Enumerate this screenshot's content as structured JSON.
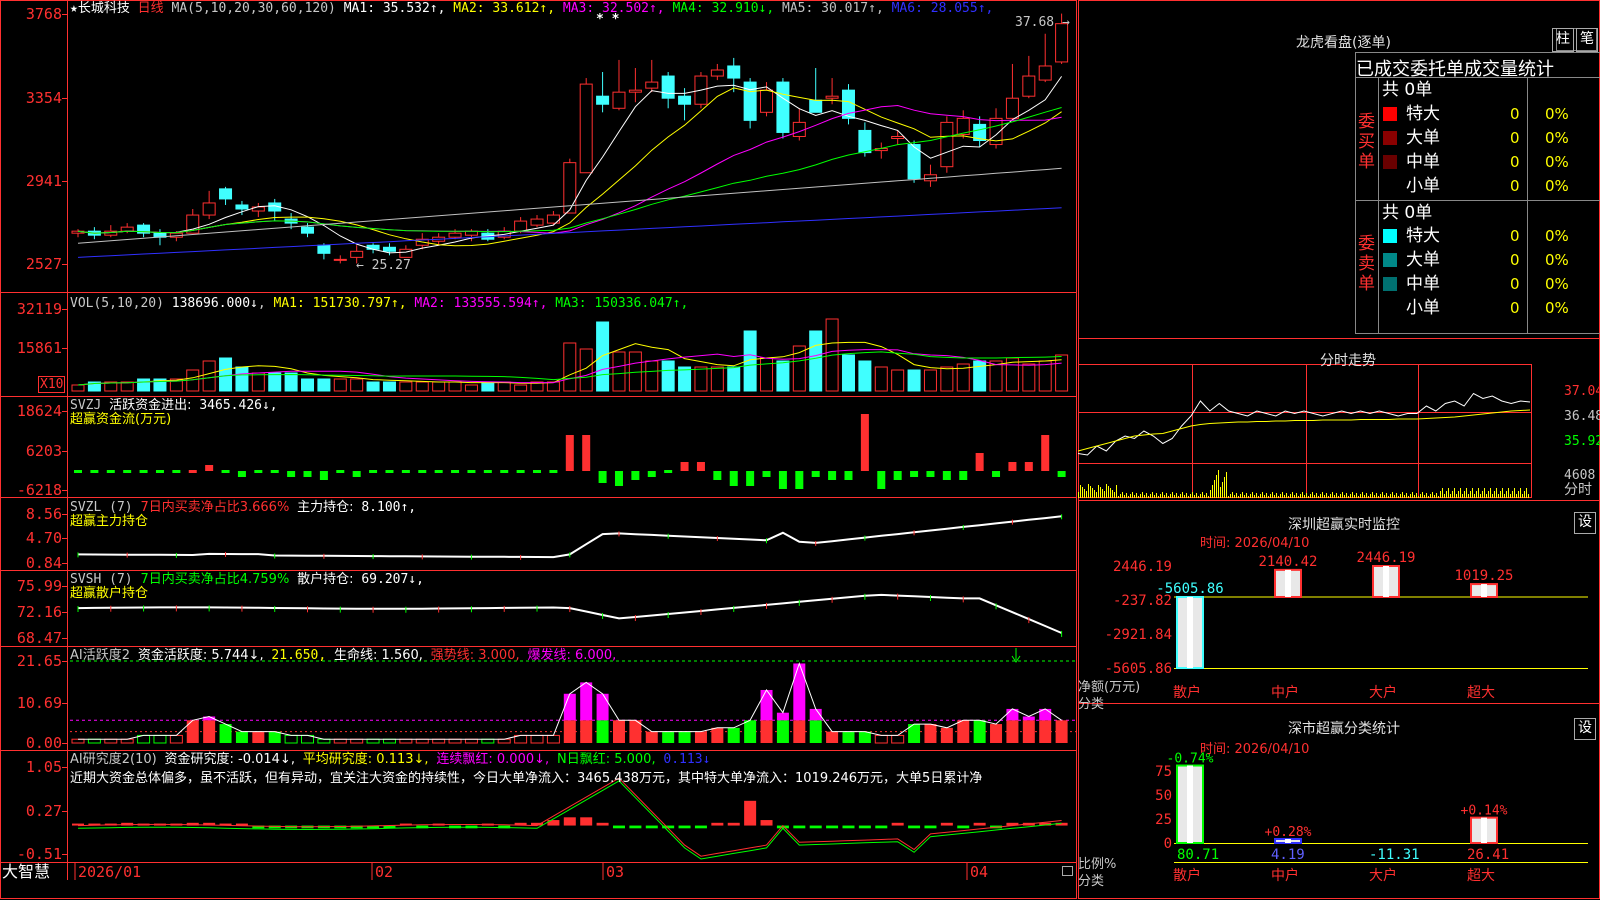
{
  "stock": {
    "star": "★",
    "name": "长城科技",
    "period": "日线"
  },
  "main": {
    "ma_header": "MA(5,10,20,30,60,120)",
    "ma": [
      {
        "label": "MA1: 35.532↑",
        "color": "#ffffff"
      },
      {
        "label": "MA2: 33.612↑",
        "color": "#ffff00"
      },
      {
        "label": "MA3: 32.502↑",
        "color": "#ff00ff"
      },
      {
        "label": "MA4: 32.910↓",
        "color": "#00ff00"
      },
      {
        "label": "MA5: 30.017↑",
        "color": "#c0c0c0"
      },
      {
        "label": "MA6: 28.055↑",
        "color": "#3030ff"
      }
    ],
    "ylabels": [
      "3768",
      "3354",
      "2941",
      "2527"
    ],
    "ylabel_values": [
      37.68,
      33.54,
      29.41,
      25.27
    ],
    "high_label": "37.68",
    "low_label": "25.27",
    "marks": "* *"
  },
  "vol": {
    "header": "VOL(5,10,20)",
    "value": "138696.000↓",
    "ma": [
      {
        "label": "MA1: 151730.797↑",
        "color": "#ffff00"
      },
      {
        "label": "MA2: 133555.594↑",
        "color": "#ff00ff"
      },
      {
        "label": "MA3: 150336.047↑",
        "color": "#00ff00"
      }
    ],
    "ylabels": [
      "32119",
      "15861"
    ],
    "unit": "X10"
  },
  "svzj": {
    "header": "SVZJ",
    "item": "活跃资金进出:",
    "value": "3465.426↓,",
    "sub": "超赢资金流(万元)",
    "ylabels": [
      "18624",
      "6203",
      "-6218"
    ]
  },
  "svzl": {
    "header": "SVZL (7)",
    "item": "7日内买卖净占比3.666%",
    "item2": "主力持仓:",
    "value": "8.100↑,",
    "sub": "超赢主力持仓",
    "ylabels": [
      "8.56",
      "4.70",
      "0.84"
    ]
  },
  "svsh": {
    "header": "SVSH (7)",
    "item": "7日内买卖净占比4.759%",
    "item2": "散户持仓:",
    "value": "69.207↓,",
    "sub": "超赢散户持仓",
    "ylabels": [
      "75.99",
      "72.16",
      "68.47"
    ]
  },
  "ai1": {
    "header": "AI活跃度2",
    "a": "资金活跃度: 5.744↓,",
    "b": "21.650,",
    "c": "生命线: 1.560,",
    "d": "强势线: 3.000,",
    "e": "爆发线: 6.000,",
    "ylabels": [
      "21.65",
      "10.69",
      "0.00"
    ]
  },
  "ai2": {
    "header": "AI研究度2(10)",
    "a": "资金研究度: -0.014↓,",
    "b": "平均研究度: 0.113↓,",
    "c": "连续飘红: 0.000↓,",
    "d": "N日飘红: 5.000,",
    "e": "0.113↓",
    "comment": "近期大资金总体偏多，虽不活跃，但有异动，宜关注大资金的持续性，今日大单净流入：3465.438万元，其中特大单净流入：1019.246万元，大单5日累计净",
    "ylabels": [
      "1.05",
      "0.27",
      "-0.51"
    ]
  },
  "xaxis": {
    "labels": [
      "2026/01",
      "02",
      "03",
      "04"
    ],
    "brand": "大智慧"
  },
  "lhb": {
    "title": "龙虎看盘(逐单)",
    "btn1": "柱",
    "btn2": "笔",
    "subtitle": "已成交委托单成交量统计",
    "buy_side": "委买单",
    "sell_side": "委卖单",
    "buy_total": "共 0单",
    "sell_total": "共 0单",
    "buy_rows": [
      {
        "label": "特大",
        "count": "0",
        "pct": "0%",
        "color": "#ff0000"
      },
      {
        "label": "大单",
        "count": "0",
        "pct": "0%",
        "color": "#8b0000"
      },
      {
        "label": "中单",
        "count": "0",
        "pct": "0%",
        "color": "#6a0000"
      },
      {
        "label": "小单",
        "count": "0",
        "pct": "0%",
        "color": ""
      }
    ],
    "sell_rows": [
      {
        "label": "特大",
        "count": "0",
        "pct": "0%",
        "color": "#00ffff"
      },
      {
        "label": "大单",
        "count": "0",
        "pct": "0%",
        "color": "#008888"
      },
      {
        "label": "中单",
        "count": "0",
        "pct": "0%",
        "color": "#007070"
      },
      {
        "label": "小单",
        "count": "0",
        "pct": "0%",
        "color": ""
      }
    ]
  },
  "intraday": {
    "title": "分时走势",
    "ylabels": [
      "37.04",
      "36.48",
      "35.92"
    ],
    "vol_label": "4608",
    "unit": "分时",
    "price": [
      35.75,
      35.72,
      35.9,
      35.8,
      36.0,
      36.1,
      36.05,
      36.2,
      36.1,
      35.95,
      36.05,
      36.3,
      36.5,
      36.8,
      36.6,
      36.75,
      36.6,
      36.55,
      36.5,
      36.6,
      36.55,
      36.5,
      36.6,
      36.55,
      36.6,
      36.55,
      36.5,
      36.55,
      36.6,
      36.55,
      36.6,
      36.55,
      36.6,
      36.55,
      36.5,
      36.55,
      36.55,
      36.7,
      36.6,
      36.75,
      36.8,
      36.7,
      36.95,
      36.85,
      36.9,
      36.8,
      36.75,
      36.8,
      36.78
    ],
    "avg": [
      35.8,
      35.85,
      35.9,
      35.95,
      36.0,
      36.05,
      36.1,
      36.12,
      36.14,
      36.15,
      36.2,
      36.25,
      36.3,
      36.33,
      36.35,
      36.36,
      36.37,
      36.38,
      36.38,
      36.39,
      36.39,
      36.4,
      36.4,
      36.41,
      36.41,
      36.41,
      36.42,
      36.42,
      36.42,
      36.42,
      36.43,
      36.43,
      36.43,
      36.43,
      36.44,
      36.44,
      36.44,
      36.45,
      36.46,
      36.47,
      36.48,
      36.5,
      36.52,
      36.54,
      36.56,
      36.58,
      36.6,
      36.61,
      36.62
    ]
  },
  "sz_monitor": {
    "title": "深圳超赢实时监控",
    "btn": "设",
    "time_label": "时间: 2026/04/10",
    "ylabels": [
      "2446.19",
      "-237.82",
      "-2921.84",
      "-5605.86"
    ],
    "ylabel": "净额(万元)",
    "xlabel": "分类",
    "categories": [
      "散户",
      "中户",
      "大户",
      "超大"
    ],
    "values": [
      -5605.86,
      2140.42,
      2446.19,
      1019.25
    ],
    "value_labels": [
      "-5605.86",
      "2140.42",
      "2446.19",
      "1019.25"
    ]
  },
  "sz_class": {
    "title": "深市超赢分类统计",
    "btn": "设",
    "time_label": "时间: 2026/04/10",
    "ylabels": [
      "75",
      "50",
      "25",
      "0"
    ],
    "ylabel": "比例%",
    "xlabel": "分类",
    "categories": [
      "散户",
      "中户",
      "大户",
      "超大"
    ],
    "values": [
      80.71,
      4.19,
      -11.31,
      26.41
    ],
    "value_labels": [
      "80.71",
      "4.19",
      "-11.31",
      "26.41"
    ],
    "change_labels": [
      "-0.74%",
      "+0.28%",
      "",
      "+0.14%"
    ]
  }
}
